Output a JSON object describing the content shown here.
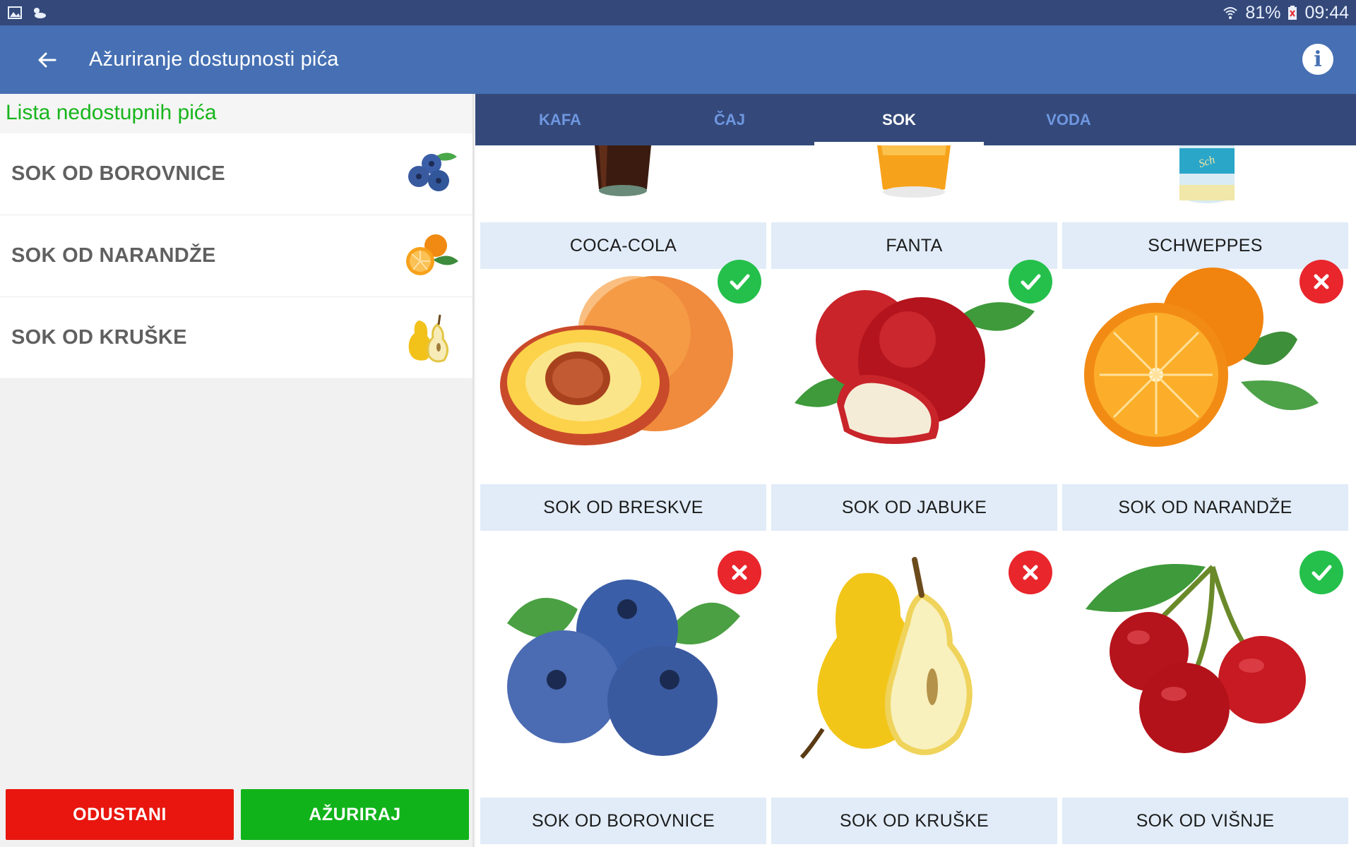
{
  "status_bar": {
    "battery": "81%",
    "time": "09:44"
  },
  "appbar": {
    "title": "Ažuriranje dostupnosti pića"
  },
  "left_panel": {
    "header": "Lista nedostupnih pića",
    "items": [
      {
        "label": "SOK OD BOROVNICE",
        "icon": "blueberry-icon"
      },
      {
        "label": "SOK OD NARANDŽE",
        "icon": "orange-icon"
      },
      {
        "label": "SOK OD KRUŠKE",
        "icon": "pear-icon"
      }
    ],
    "cancel_label": "ODUSTANI",
    "update_label": "AŽURIRAJ"
  },
  "tabs": [
    {
      "label": "KAFA",
      "active": false
    },
    {
      "label": "ČAJ",
      "active": false
    },
    {
      "label": "SOK",
      "active": true
    },
    {
      "label": "VODA",
      "active": false
    }
  ],
  "drinks": [
    {
      "label": "COCA-COLA",
      "image": "coca-cola-glass"
    },
    {
      "label": "FANTA",
      "image": "fanta-glass"
    },
    {
      "label": "SCHWEPPES",
      "image": "schweppes-bottle"
    },
    {
      "label": "SOK OD BRESKVE",
      "image": "peach",
      "available": true
    },
    {
      "label": "SOK OD JABUKE",
      "image": "apple",
      "available": true
    },
    {
      "label": "SOK OD NARANDŽE",
      "image": "orange",
      "available": false
    },
    {
      "label": "SOK OD BOROVNICE",
      "image": "blueberry",
      "available": false
    },
    {
      "label": "SOK OD KRUŠKE",
      "image": "pear",
      "available": false
    },
    {
      "label": "SOK OD VIŠNJE",
      "image": "cherry",
      "available": true
    }
  ]
}
